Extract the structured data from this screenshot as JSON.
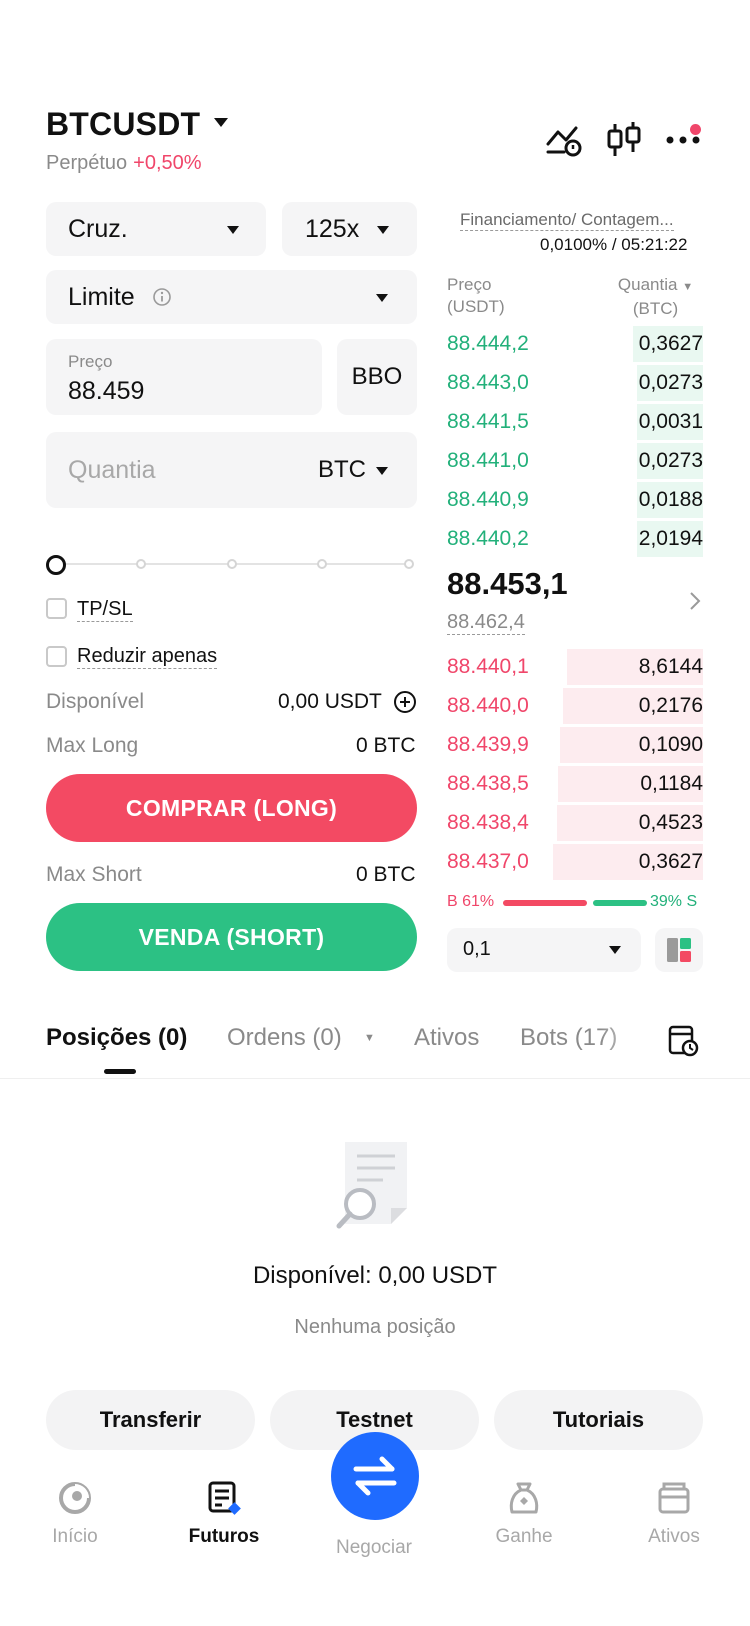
{
  "header": {
    "pair": "BTCUSDT",
    "contract_type": "Perpétuo",
    "change": "+0,50%"
  },
  "form": {
    "margin_mode": "Cruz.",
    "leverage": "125x",
    "order_type": "Limite",
    "price_label": "Preço",
    "price_value": "88.459",
    "bbo_label": "BBO",
    "quantity_placeholder": "Quantia",
    "quantity_unit": "BTC",
    "tpsl_label": "TP/SL",
    "reduce_label": "Reduzir apenas",
    "available_label": "Disponível",
    "available_value": "0,00 USDT",
    "max_long_label": "Max Long",
    "max_long_value": "0 BTC",
    "buy_label": "COMPRAR (LONG)",
    "max_short_label": "Max Short",
    "max_short_value": "0 BTC",
    "sell_label": "VENDA (SHORT)"
  },
  "funding": {
    "label": "Financiamento/ Contagem...",
    "value": "0,0100% / 05:21:22"
  },
  "orderbook": {
    "price_header": "Preço",
    "price_unit": "(USDT)",
    "qty_header": "Quantia",
    "qty_unit": "(BTC)",
    "asks": [
      {
        "price": "88.444,2",
        "qty": "0,3627"
      },
      {
        "price": "88.443,0",
        "qty": "0,0273"
      },
      {
        "price": "88.441,5",
        "qty": "0,0031"
      },
      {
        "price": "88.441,0",
        "qty": "0,0273"
      },
      {
        "price": "88.440,9",
        "qty": "0,0188"
      },
      {
        "price": "88.440,2",
        "qty": "2,0194"
      }
    ],
    "last_price": "88.453,1",
    "mark_price": "88.462,4",
    "bids": [
      {
        "price": "88.440,1",
        "qty": "8,6144"
      },
      {
        "price": "88.440,0",
        "qty": "0,2176"
      },
      {
        "price": "88.439,9",
        "qty": "0,1090"
      },
      {
        "price": "88.438,5",
        "qty": "0,1184"
      },
      {
        "price": "88.438,4",
        "qty": "0,4523"
      },
      {
        "price": "88.437,0",
        "qty": "0,3627"
      }
    ],
    "buy_ratio": "B 61%",
    "sell_ratio": "39% S",
    "buy_ratio_value": 0.61,
    "precision": "0,1"
  },
  "tabs": {
    "positions": "Posições (0)",
    "orders": "Ordens (0)",
    "assets": "Ativos",
    "bots": "Bots (17)"
  },
  "empty_state": {
    "available": "Disponível: 0,00 USDT",
    "message": "Nenhuma posição"
  },
  "actions": {
    "transfer": "Transferir",
    "testnet": "Testnet",
    "tutorials": "Tutoriais"
  },
  "nav": {
    "home": "Início",
    "futures": "Futuros",
    "trade": "Negociar",
    "earn": "Ganhe",
    "assets": "Ativos"
  },
  "colors": {
    "buy": "#f34a63",
    "sell": "#2cc184",
    "ask_text": "#22b07a",
    "bid_text": "#f0466a",
    "accent_blue": "#1f6bff"
  }
}
